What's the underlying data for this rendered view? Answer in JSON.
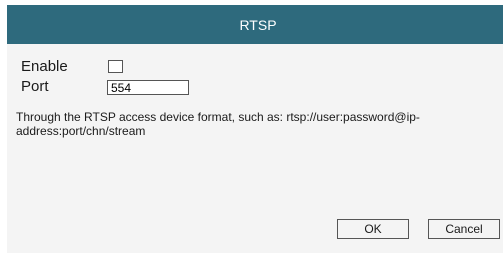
{
  "dialog": {
    "title": "RTSP",
    "enable_label": "Enable",
    "enable_checked": false,
    "port_label": "Port",
    "port_value": "554",
    "description": "Through the RTSP access device format, such as: rtsp://user:password@ip-address:port/chn/stream",
    "ok_label": "OK",
    "cancel_label": "Cancel"
  },
  "colors": {
    "titlebar": "#2e6a7d",
    "background": "#f4f4f4"
  }
}
